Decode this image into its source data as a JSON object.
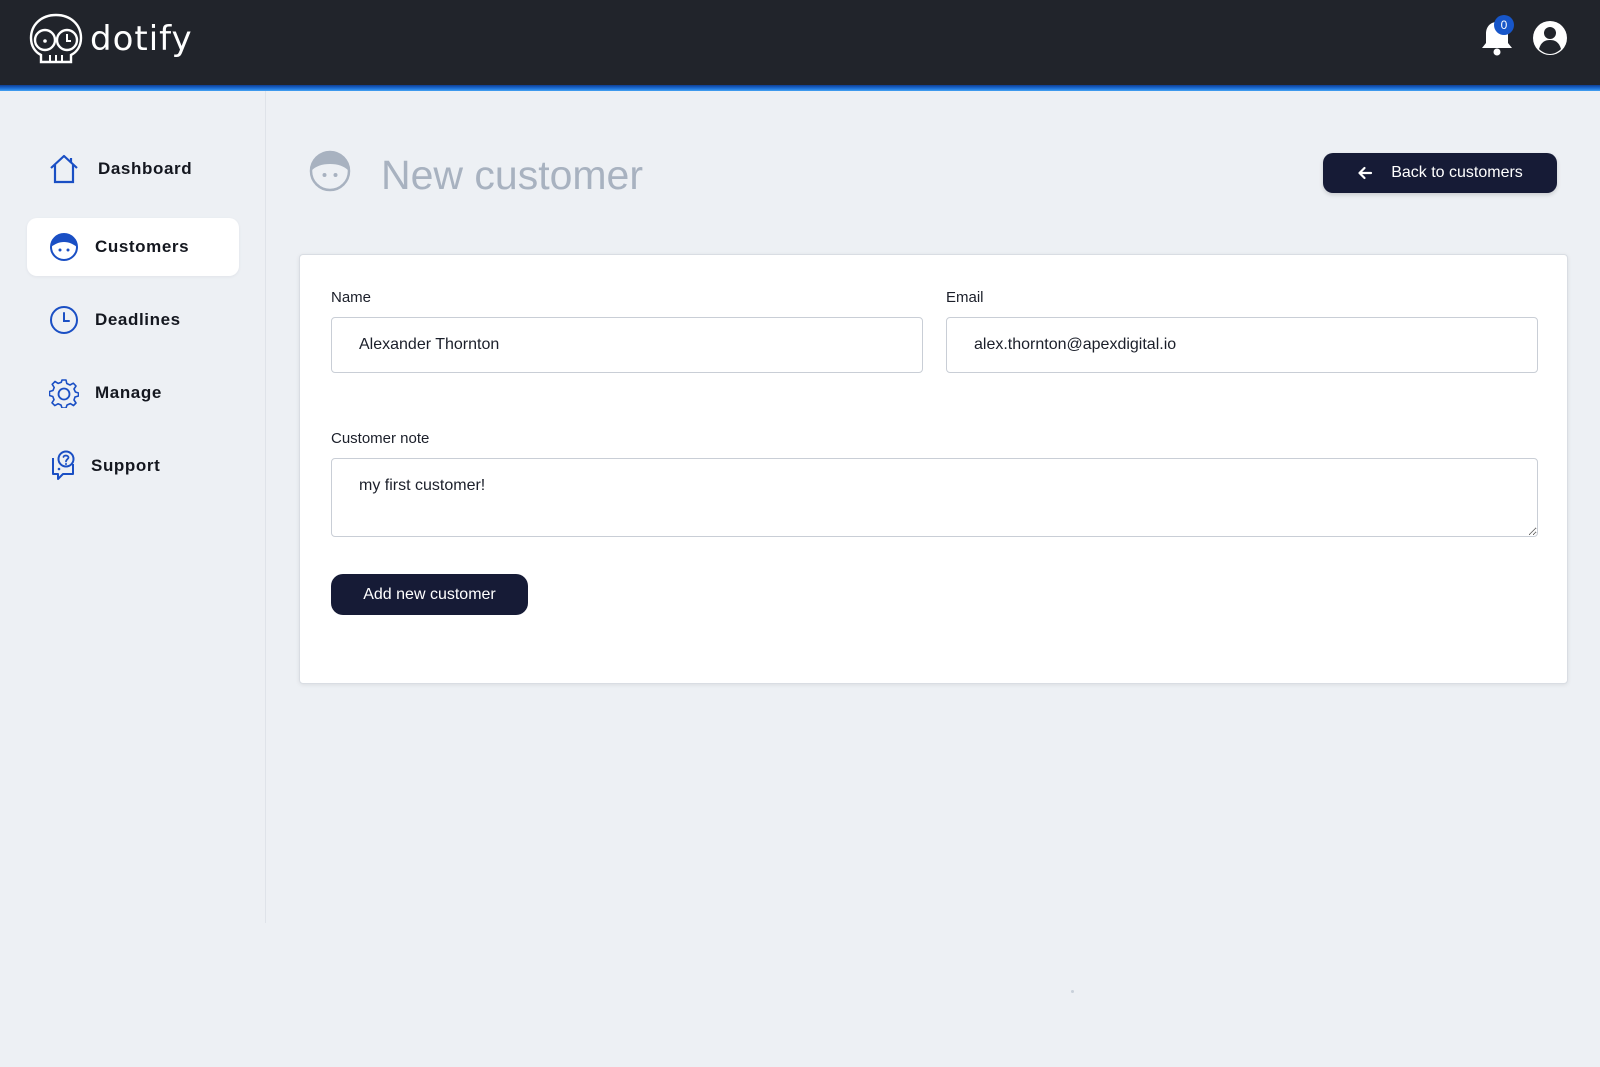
{
  "app": {
    "logo_text": "dotify"
  },
  "header": {
    "notification_count": "0"
  },
  "sidebar": {
    "items": [
      {
        "label": "Dashboard",
        "icon": "home-icon",
        "active": false
      },
      {
        "label": "Customers",
        "icon": "customer-face-icon",
        "active": true
      },
      {
        "label": "Deadlines",
        "icon": "clock-icon",
        "active": false
      },
      {
        "label": "Manage",
        "icon": "gear-icon",
        "active": false
      },
      {
        "label": "Support",
        "icon": "support-icon",
        "active": false
      }
    ]
  },
  "page": {
    "title": "New customer",
    "back_button_label": "Back to customers"
  },
  "form": {
    "name_label": "Name",
    "name_value": "Alexander Thornton",
    "email_label": "Email",
    "email_value": "alex.thornton@apexdigital.io",
    "note_label": "Customer note",
    "note_value": "my first customer!",
    "submit_label": "Add new customer"
  },
  "colors": {
    "topbar": "#21242b",
    "accent": "#1d6fd6",
    "primary_button": "#161b36",
    "page_background": "#edf0f4",
    "icon_blue": "#1a4fc4"
  }
}
